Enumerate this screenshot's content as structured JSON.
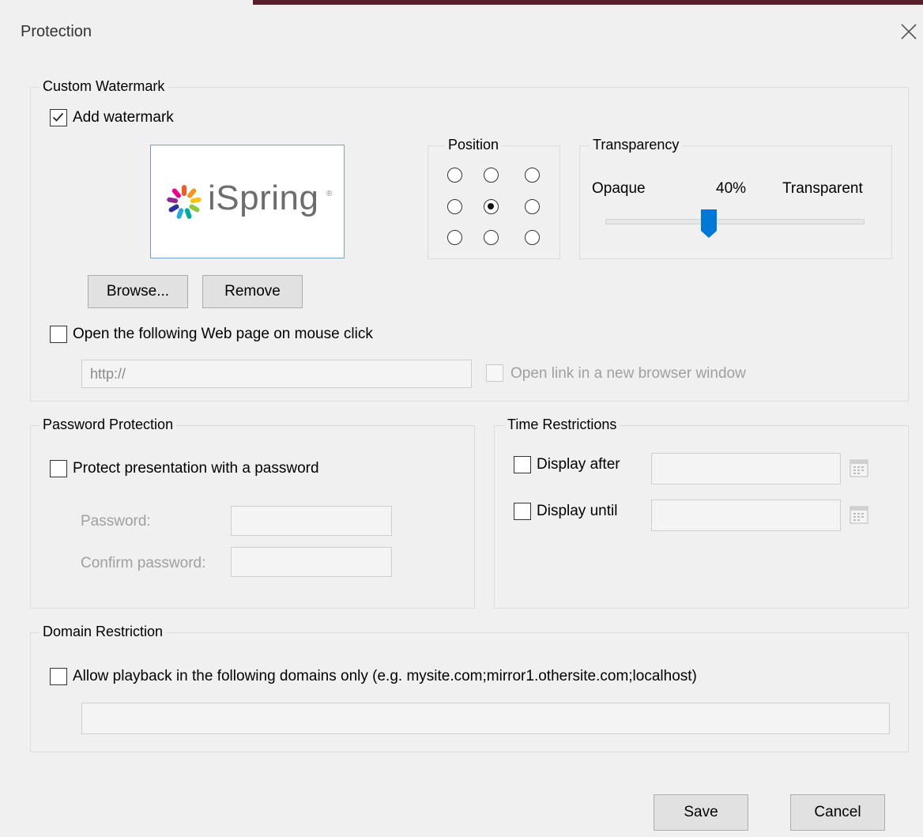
{
  "dialog": {
    "title": "Protection"
  },
  "watermark": {
    "legend": "Custom Watermark",
    "add_label": "Add watermark",
    "add_checked": true,
    "logo_text": "iSpring",
    "logo_mark": "®",
    "browse_label": "Browse...",
    "remove_label": "Remove",
    "open_page_label": "Open the following Web page on mouse click",
    "url_value": "http://",
    "new_window_label": "Open link in a new browser window"
  },
  "position": {
    "legend": "Position",
    "selected_index": 4
  },
  "transparency": {
    "legend": "Transparency",
    "opaque_label": "Opaque",
    "value_label": "40%",
    "transparent_label": "Transparent",
    "value": 0.4
  },
  "password": {
    "legend": "Password Protection",
    "protect_label": "Protect presentation with a password",
    "password_label": "Password:",
    "confirm_label": "Confirm password:"
  },
  "time": {
    "legend": "Time Restrictions",
    "after_label": "Display after",
    "until_label": "Display until"
  },
  "domain": {
    "legend": "Domain Restriction",
    "allow_label": "Allow playback in the following domains only (e.g. mysite.com;mirror1.othersite.com;localhost)"
  },
  "footer": {
    "save_label": "Save",
    "cancel_label": "Cancel"
  },
  "colors": {
    "accent": "#0078d7",
    "title_strip": "#5a1f2b"
  },
  "icons": [
    "close-icon",
    "checkmark-icon",
    "ispring-logo-icon",
    "calendar-icon",
    "slider-thumb-icon"
  ]
}
